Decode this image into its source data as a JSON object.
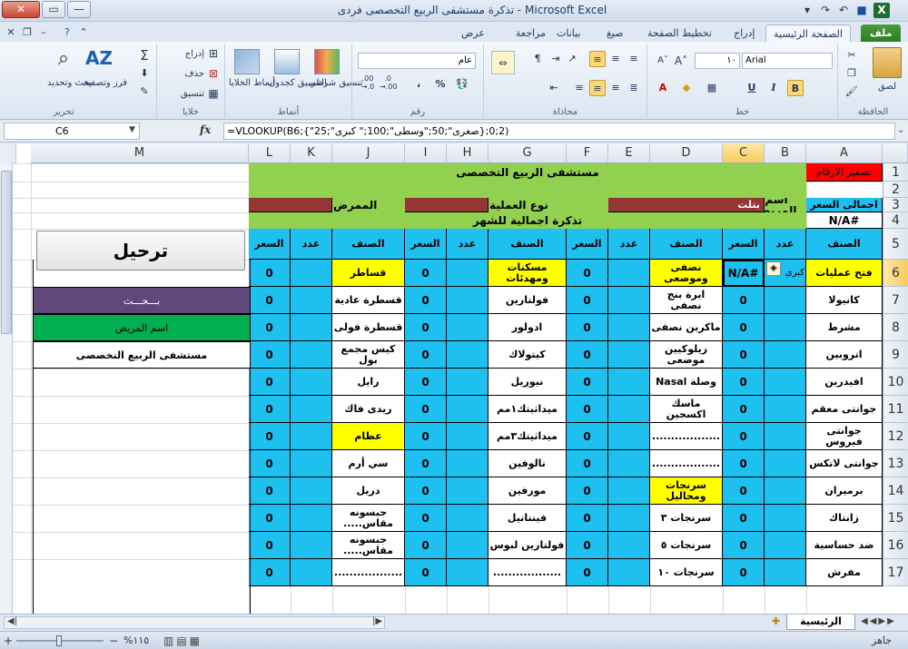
{
  "window": {
    "title": "تذكرة مستشفى الربيع التخصصى فردى - Microsoft Excel",
    "close": "✕",
    "maximize": "▭",
    "minimize": "—"
  },
  "tabs": [
    "ملف",
    "الصفحة الرئيسية",
    "إدراج",
    "تخطيط الصفحة",
    "صيغ",
    "بيانات",
    "مراجعة",
    "عرض"
  ],
  "ribbon": {
    "clipboard": {
      "label": "الحافظة",
      "paste": "لصق"
    },
    "font": {
      "label": "خط",
      "name": "Arial",
      "size": "١٠",
      "bold": "B",
      "italic": "I",
      "underline": "U"
    },
    "alignment": {
      "label": "محاذاة"
    },
    "number": {
      "label": "رقم",
      "format": "عام",
      "percent": "%",
      "comma": "،",
      "inc": ".00\n→.0",
      "dec": ".0\n→.00"
    },
    "styles": {
      "label": "أنماط",
      "conditional": "تنسيق\nشرطي",
      "table": "التنسيق\nكجدول",
      "cell": "أنماط\nالخلايا"
    },
    "cells": {
      "label": "خلايا",
      "insert": "إدراج",
      "delete": "حذف",
      "format": "تنسيق"
    },
    "editing": {
      "label": "تحرير",
      "sort": "فرز\nوتصفية",
      "find": "بحث\nوتحديد",
      "sum": "Σ"
    }
  },
  "formula_bar": {
    "name_box": "C6",
    "fx": "fx",
    "formula": "=VLOOKUP(B6;{\"صغرى\";50;\"وسطى\";100;\" كبرى\";25};2;0)"
  },
  "columns": [
    "A",
    "B",
    "C",
    "D",
    "E",
    "F",
    "G",
    "H",
    "I",
    "J",
    "K",
    "L",
    "M"
  ],
  "rows": [
    "1",
    "2",
    "3",
    "4",
    "5",
    "6",
    "7",
    "8",
    "9",
    "10",
    "11",
    "12",
    "13",
    "14",
    "15",
    "16",
    "17"
  ],
  "sheet": {
    "a1": "تصفير الارقام",
    "title": "مستشفى الربيع التخصصى",
    "patient_name_label": "اسم المريض",
    "patient_name_value": "بتلت",
    "op_type_label": "نوع العملية",
    "patient_label": "الممرض",
    "a3": "اجمالى السعر",
    "a4": "#N/A",
    "subtitle": "تذكرة اجمالية للشهر",
    "hdr_item": "الصنف",
    "hdr_count": "عدد",
    "hdr_price": "السعر",
    "b6": "كبرى",
    "c6": "#N/A",
    "colA": [
      "فتح عمليات",
      "كانيولا",
      "مشرط",
      "اتروبين",
      "افيدرين",
      "جوانتى معقم",
      "جوانتى فيروس",
      "جوانتى لاتكس",
      "برميران",
      "زانتاك",
      "ضد حساسية",
      "مفرش"
    ],
    "colD": [
      "نصفى وموضعى",
      "ابرة بنج نصفى",
      "ماكرين نصفى",
      "زيلوكيين موضعى",
      "وصلة Nasal",
      "ماسك اكسجين",
      "..................",
      "..................",
      "سرنجات ومحاليل",
      "سرنجات ٣",
      "سرنجات ٥",
      "سرنجات ١٠"
    ],
    "colG": [
      "مسكنات ومهدئات",
      "فولتارين",
      "ادولور",
      "كيتولاك",
      "نيوريل",
      "ميداثيتك١مم",
      "ميداثيتك٣مم",
      "نالوفين",
      "مورفين",
      "فينتانيل",
      "فولتارين لبوس",
      ".................."
    ],
    "colJ": [
      "قساطر",
      "قسطرة عادية",
      "قسطرة فولى",
      "كيس مجمع بول",
      "رايل",
      "ريدى فاك",
      "عظام",
      "سي أرم",
      "دريل",
      "جبسونه مقاس.....",
      "جبسونه مقاس.....",
      ".................."
    ],
    "zero": "0",
    "deport_btn": "ترحيل",
    "search_label": "بـــحـــث",
    "search_patient": "اسم المريض",
    "search_hospital": "مستشفى الربيع التخصصى"
  },
  "sheet_tabs": {
    "active": "الرئيسية"
  },
  "status": {
    "ready": "جاهز",
    "zoom": "%١١٥",
    "minus": "−",
    "plus": "+"
  }
}
